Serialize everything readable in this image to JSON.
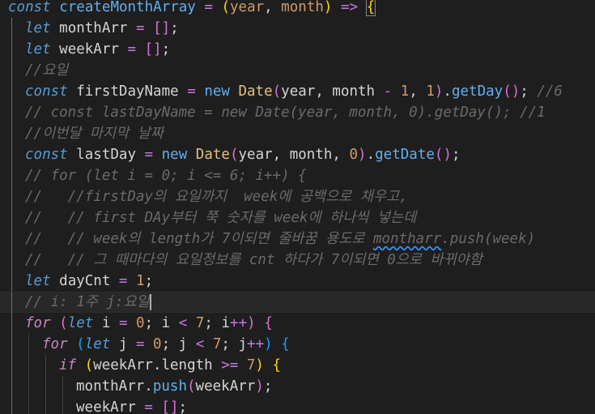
{
  "editor": {
    "language": "javascript",
    "theme_background": "#1e1e1e",
    "active_line_index": 14,
    "lines": [
      {
        "indent": 0,
        "tokens": [
          {
            "t": "const",
            "c": "k"
          },
          {
            "t": " ",
            "c": "p"
          },
          {
            "t": "createMonthArray",
            "c": "fn"
          },
          {
            "t": " ",
            "c": "p"
          },
          {
            "t": "=",
            "c": "o"
          },
          {
            "t": " ",
            "c": "p"
          },
          {
            "t": "(",
            "c": "b1"
          },
          {
            "t": "year",
            "c": "n"
          },
          {
            "t": ", ",
            "c": "p"
          },
          {
            "t": "month",
            "c": "n"
          },
          {
            "t": ")",
            "c": "b1"
          },
          {
            "t": " ",
            "c": "p"
          },
          {
            "t": "=>",
            "c": "o"
          },
          {
            "t": " ",
            "c": "p"
          },
          {
            "t": "{",
            "c": "b1box"
          }
        ]
      },
      {
        "indent": 1,
        "tokens": [
          {
            "t": "let",
            "c": "k"
          },
          {
            "t": " ",
            "c": "p"
          },
          {
            "t": "monthArr",
            "c": "p"
          },
          {
            "t": " ",
            "c": "p"
          },
          {
            "t": "=",
            "c": "o"
          },
          {
            "t": " ",
            "c": "p"
          },
          {
            "t": "[]",
            "c": "b2"
          },
          {
            "t": ";",
            "c": "p"
          }
        ]
      },
      {
        "indent": 1,
        "tokens": [
          {
            "t": "let",
            "c": "k"
          },
          {
            "t": " ",
            "c": "p"
          },
          {
            "t": "weekArr",
            "c": "p"
          },
          {
            "t": " ",
            "c": "p"
          },
          {
            "t": "=",
            "c": "o"
          },
          {
            "t": " ",
            "c": "p"
          },
          {
            "t": "[]",
            "c": "b2"
          },
          {
            "t": ";",
            "c": "p"
          }
        ]
      },
      {
        "indent": 1,
        "tokens": [
          {
            "t": "//요일",
            "c": "c"
          }
        ]
      },
      {
        "indent": 1,
        "tokens": [
          {
            "t": "const",
            "c": "k"
          },
          {
            "t": " ",
            "c": "p"
          },
          {
            "t": "firstDayName",
            "c": "p"
          },
          {
            "t": " ",
            "c": "p"
          },
          {
            "t": "=",
            "c": "o"
          },
          {
            "t": " ",
            "c": "p"
          },
          {
            "t": "new",
            "c": "fn"
          },
          {
            "t": " ",
            "c": "p"
          },
          {
            "t": "Date",
            "c": "cls"
          },
          {
            "t": "(",
            "c": "b2"
          },
          {
            "t": "year",
            "c": "p"
          },
          {
            "t": ", ",
            "c": "p"
          },
          {
            "t": "month",
            "c": "p"
          },
          {
            "t": " - ",
            "c": "o"
          },
          {
            "t": "1",
            "c": "n"
          },
          {
            "t": ", ",
            "c": "p"
          },
          {
            "t": "1",
            "c": "n"
          },
          {
            "t": ")",
            "c": "b2"
          },
          {
            "t": ".",
            "c": "p"
          },
          {
            "t": "getDay",
            "c": "fn"
          },
          {
            "t": "()",
            "c": "b2"
          },
          {
            "t": "; ",
            "c": "p"
          },
          {
            "t": "//6",
            "c": "c"
          }
        ]
      },
      {
        "indent": 1,
        "tokens": [
          {
            "t": "// const lastDayName = new Date(year, month, 0).getDay(); //1",
            "c": "c"
          }
        ]
      },
      {
        "indent": 1,
        "tokens": [
          {
            "t": "//이번달 마지막 날짜",
            "c": "c"
          }
        ]
      },
      {
        "indent": 1,
        "tokens": [
          {
            "t": "const",
            "c": "k"
          },
          {
            "t": " ",
            "c": "p"
          },
          {
            "t": "lastDay",
            "c": "p"
          },
          {
            "t": " ",
            "c": "p"
          },
          {
            "t": "=",
            "c": "o"
          },
          {
            "t": " ",
            "c": "p"
          },
          {
            "t": "new",
            "c": "fn"
          },
          {
            "t": " ",
            "c": "p"
          },
          {
            "t": "Date",
            "c": "cls"
          },
          {
            "t": "(",
            "c": "b2"
          },
          {
            "t": "year",
            "c": "p"
          },
          {
            "t": ", ",
            "c": "p"
          },
          {
            "t": "month",
            "c": "p"
          },
          {
            "t": ", ",
            "c": "p"
          },
          {
            "t": "0",
            "c": "n"
          },
          {
            "t": ")",
            "c": "b2"
          },
          {
            "t": ".",
            "c": "p"
          },
          {
            "t": "getDate",
            "c": "fn"
          },
          {
            "t": "()",
            "c": "b2"
          },
          {
            "t": ";",
            "c": "p"
          }
        ]
      },
      {
        "indent": 1,
        "tokens": [
          {
            "t": "// for (let i = 0; i <= 6; i++) {",
            "c": "c"
          }
        ]
      },
      {
        "indent": 1,
        "tokens": [
          {
            "t": "//   //firstDay의 요일까지  week에 공백으로 채우고,",
            "c": "c"
          }
        ]
      },
      {
        "indent": 1,
        "tokens": [
          {
            "t": "//   // first DAy부터 쭉 숫자를 week에 하나씩 넣는데",
            "c": "c"
          }
        ]
      },
      {
        "indent": 1,
        "tokens": [
          {
            "t": "//   // week의 length가 7이되면 줄바꿈 용도로 ",
            "c": "c"
          },
          {
            "t": "montharr",
            "c": "csq"
          },
          {
            "t": ".push(week)",
            "c": "c"
          }
        ]
      },
      {
        "indent": 1,
        "tokens": [
          {
            "t": "//   // 그 때마다의 요일정보를 cnt 하다가 7이되면 0으로 바뀌야함",
            "c": "c"
          }
        ]
      },
      {
        "indent": 1,
        "tokens": [
          {
            "t": "let",
            "c": "k"
          },
          {
            "t": " ",
            "c": "p"
          },
          {
            "t": "dayCnt",
            "c": "p"
          },
          {
            "t": " ",
            "c": "p"
          },
          {
            "t": "=",
            "c": "o"
          },
          {
            "t": " ",
            "c": "p"
          },
          {
            "t": "1",
            "c": "n"
          },
          {
            "t": ";",
            "c": "p"
          }
        ]
      },
      {
        "indent": 1,
        "tokens": [
          {
            "t": "// i: 1주 j:요일",
            "c": "c"
          }
        ]
      },
      {
        "indent": 1,
        "tokens": [
          {
            "t": "for",
            "c": "kw"
          },
          {
            "t": " ",
            "c": "p"
          },
          {
            "t": "(",
            "c": "b2"
          },
          {
            "t": "let",
            "c": "k"
          },
          {
            "t": " ",
            "c": "p"
          },
          {
            "t": "i",
            "c": "p"
          },
          {
            "t": " ",
            "c": "p"
          },
          {
            "t": "=",
            "c": "o"
          },
          {
            "t": " ",
            "c": "p"
          },
          {
            "t": "0",
            "c": "n"
          },
          {
            "t": "; ",
            "c": "p"
          },
          {
            "t": "i",
            "c": "p"
          },
          {
            "t": " ",
            "c": "p"
          },
          {
            "t": "<",
            "c": "o"
          },
          {
            "t": " ",
            "c": "p"
          },
          {
            "t": "7",
            "c": "n"
          },
          {
            "t": "; ",
            "c": "p"
          },
          {
            "t": "i",
            "c": "p"
          },
          {
            "t": "++",
            "c": "o"
          },
          {
            "t": ")",
            "c": "b2"
          },
          {
            "t": " ",
            "c": "p"
          },
          {
            "t": "{",
            "c": "b2"
          }
        ]
      },
      {
        "indent": 2,
        "tokens": [
          {
            "t": "for",
            "c": "kw"
          },
          {
            "t": " ",
            "c": "p"
          },
          {
            "t": "(",
            "c": "b3"
          },
          {
            "t": "let",
            "c": "k"
          },
          {
            "t": " ",
            "c": "p"
          },
          {
            "t": "j",
            "c": "p"
          },
          {
            "t": " ",
            "c": "p"
          },
          {
            "t": "=",
            "c": "o"
          },
          {
            "t": " ",
            "c": "p"
          },
          {
            "t": "0",
            "c": "n"
          },
          {
            "t": "; ",
            "c": "p"
          },
          {
            "t": "j",
            "c": "p"
          },
          {
            "t": " ",
            "c": "p"
          },
          {
            "t": "<",
            "c": "o"
          },
          {
            "t": " ",
            "c": "p"
          },
          {
            "t": "7",
            "c": "n"
          },
          {
            "t": "; ",
            "c": "p"
          },
          {
            "t": "j",
            "c": "p"
          },
          {
            "t": "++",
            "c": "o"
          },
          {
            "t": ")",
            "c": "b3"
          },
          {
            "t": " ",
            "c": "p"
          },
          {
            "t": "{",
            "c": "b3"
          }
        ]
      },
      {
        "indent": 3,
        "tokens": [
          {
            "t": "if",
            "c": "kw"
          },
          {
            "t": " ",
            "c": "p"
          },
          {
            "t": "(",
            "c": "b1"
          },
          {
            "t": "weekArr",
            "c": "p"
          },
          {
            "t": ".",
            "c": "p"
          },
          {
            "t": "length",
            "c": "p"
          },
          {
            "t": " ",
            "c": "p"
          },
          {
            "t": ">=",
            "c": "o"
          },
          {
            "t": " ",
            "c": "p"
          },
          {
            "t": "7",
            "c": "n"
          },
          {
            "t": ")",
            "c": "b1"
          },
          {
            "t": " ",
            "c": "p"
          },
          {
            "t": "{",
            "c": "b1"
          }
        ]
      },
      {
        "indent": 4,
        "tokens": [
          {
            "t": "monthArr",
            "c": "p"
          },
          {
            "t": ".",
            "c": "p"
          },
          {
            "t": "push",
            "c": "fn"
          },
          {
            "t": "(",
            "c": "b2"
          },
          {
            "t": "weekArr",
            "c": "p"
          },
          {
            "t": ")",
            "c": "b2"
          },
          {
            "t": ";",
            "c": "p"
          }
        ]
      },
      {
        "indent": 4,
        "tokens": [
          {
            "t": "weekArr",
            "c": "p"
          },
          {
            "t": " ",
            "c": "p"
          },
          {
            "t": "=",
            "c": "o"
          },
          {
            "t": " ",
            "c": "p"
          },
          {
            "t": "[]",
            "c": "b2"
          },
          {
            "t": ";",
            "c": "p"
          }
        ]
      }
    ]
  }
}
